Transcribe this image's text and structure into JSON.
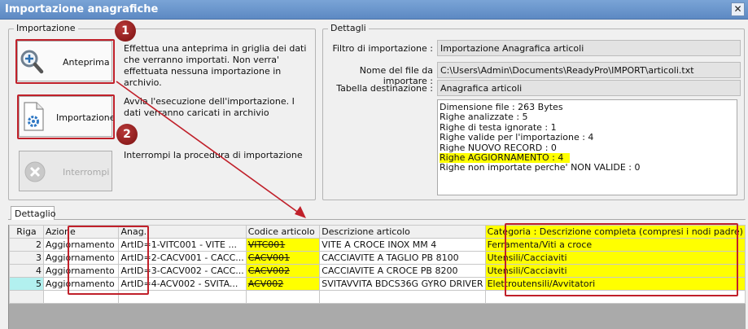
{
  "window": {
    "title": "Importazione anagrafiche",
    "close_symbol": "✕"
  },
  "import_group": {
    "legend": "Importazione",
    "preview_button": "Anteprima",
    "preview_desc": "Effettua una anteprima in griglia dei dati che verranno importati. Non verra' effettuata nessuna importazione in archivio.",
    "import_button": "Importazione",
    "import_desc": "Avvia l'esecuzione dell'importazione. I dati verranno caricati in archivio",
    "stop_button": "Interrompi",
    "stop_desc": "Interrompi la procedura di importazione"
  },
  "badges": {
    "one": "1",
    "two": "2"
  },
  "details": {
    "legend": "Dettagli",
    "filter_label": "Filtro di importazione :",
    "filter_value": "Importazione Anagrafica articoli",
    "file_label": "Nome del file da importare :",
    "file_value": "C:\\Users\\Admin\\Documents\\ReadyPro\\IMPORT\\articoli.txt",
    "table_label": "Tabella destinazione :",
    "table_value": "Anagrafica articoli",
    "stats": [
      "Dimensione file : 263 Bytes",
      "Righe analizzate : 5",
      "Righe di testa ignorate : 1",
      "Righe valide per l'importazione : 4",
      "Righe NUOVO RECORD : 0",
      "Righe AGGIORNAMENTO  : 4",
      "Righe non importate perche' NON VALIDE : 0"
    ]
  },
  "tab": {
    "label": "Dettaglio"
  },
  "grid": {
    "headers": [
      "Riga",
      "Azione",
      "Anag.",
      "Codice articolo",
      "Descrizione articolo",
      "Categoria : Descrizione completa (compresi i nodi padre)"
    ],
    "rows": [
      [
        "2",
        "Aggiornamento",
        "ArtID=1-VITC001 - VITE ...",
        "VITC001",
        "VITE A CROCE INOX MM 4",
        "Ferramenta/Viti a croce"
      ],
      [
        "3",
        "Aggiornamento",
        "ArtID=2-CACV001 - CACC...",
        "CACV001",
        "CACCIAVITE A TAGLIO PB 8100",
        "Utensili/Cacciaviti"
      ],
      [
        "4",
        "Aggiornamento",
        "ArtID=3-CACV002 - CACC...",
        "CACV002",
        "CACCIAVITE A CROCE PB 8200",
        "Utensili/Cacciaviti"
      ],
      [
        "5",
        "Aggiornamento",
        "ArtID=4-ACV002 - SVITA...",
        "ACV002",
        "SVITAVVITA BDCS36G GYRO DRIVER",
        "Elettroutensili/Avvitatori"
      ]
    ]
  },
  "colors": {
    "highlight": "#ffff00",
    "annotation_red": "#c0202a",
    "title_bar": "#6b95cc",
    "selected_row_header": "#b2f0ef"
  }
}
